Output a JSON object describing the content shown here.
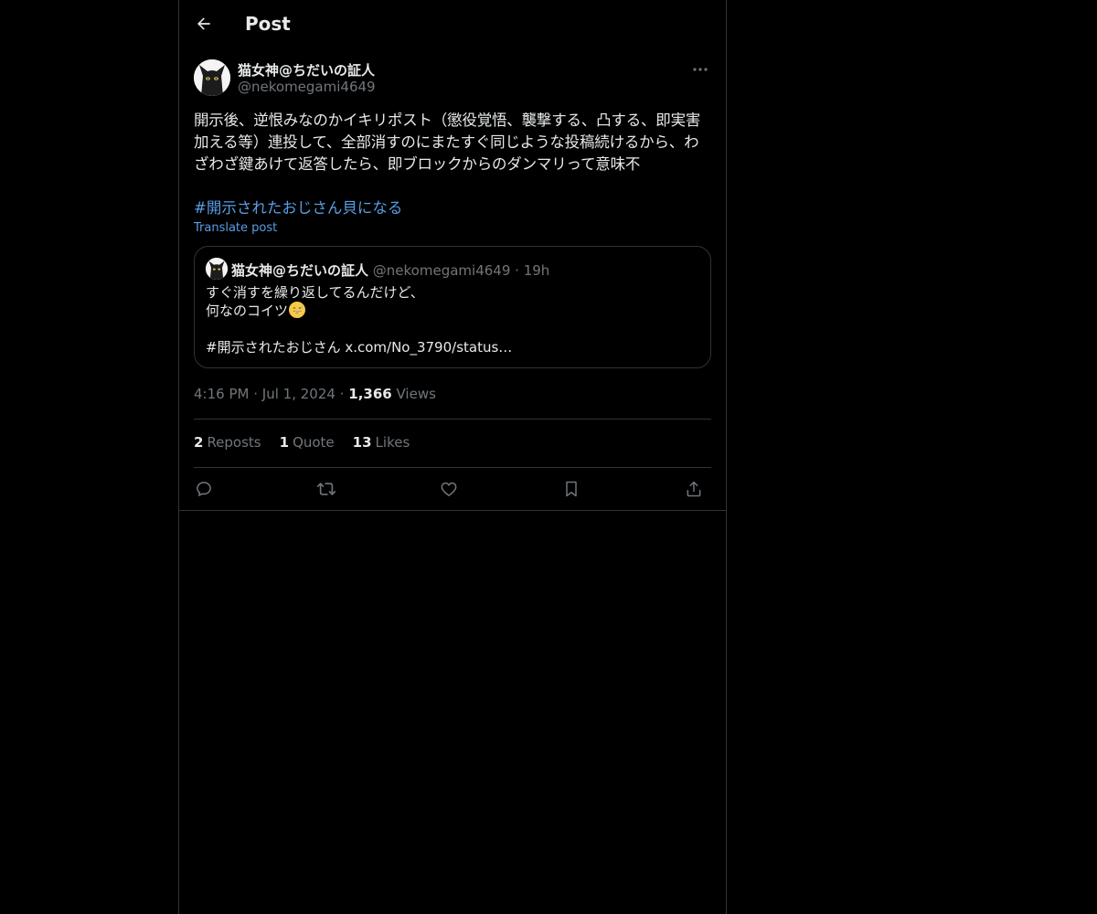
{
  "colors": {
    "background": "#000000",
    "text": "#e7e9ea",
    "muted": "#71767b",
    "link": "#5a9ee6",
    "border": "#2f3336"
  },
  "header": {
    "back_icon": "arrow-left-icon",
    "title": "Post"
  },
  "post": {
    "author_name": "猫女神@ちだいの証人",
    "author_handle": "@nekomegami4649",
    "more_icon": "more-horizontal-icon",
    "text": "開示後、逆恨みなのかイキリポスト（懲役覚悟、襲撃する、凸する、即実害加える等）連投して、全部消すのにまたすぐ同じような投稿続けるから、わざわざ鍵あけて返答したら、即ブロックからのダンマリって意味不",
    "hashtag": "#開示されたおじさん貝になる",
    "translate_label": "Translate post",
    "quote": {
      "author_name": "猫女神@ちだいの証人",
      "author_handle": "@nekomegami4649",
      "separator": "·",
      "time": "19h",
      "line1": "すぐ消すを繰り返してるんだけど、",
      "line2": "何なのコイツ",
      "line3": "",
      "line4": "#開示されたおじさん x.com/No_3790/status…"
    },
    "meta": {
      "time": "4:16 PM",
      "separator": "·",
      "date": "Jul 1, 2024",
      "views_count": "1,366",
      "views_label": "Views"
    },
    "stats": {
      "reposts_count": "2",
      "reposts_label": "Reposts",
      "quotes_count": "1",
      "quotes_label": "Quote",
      "likes_count": "13",
      "likes_label": "Likes"
    },
    "actions": [
      "reply-icon",
      "repost-icon",
      "like-icon",
      "bookmark-icon",
      "share-icon"
    ]
  }
}
